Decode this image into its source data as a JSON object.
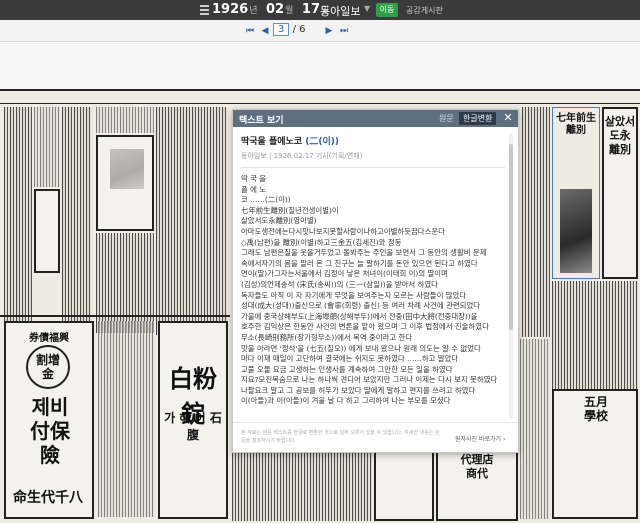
{
  "topbar": {
    "year": "1926",
    "year_unit": "년",
    "month": "02",
    "month_unit": "월",
    "day": "17",
    "day_unit": "일",
    "newspaper": "동아일보",
    "go_label": "이동",
    "notice_label": "공감게시판"
  },
  "nav": {
    "current_page": "3",
    "total_pages": "/ 6"
  },
  "panel": {
    "title": "텍스트 보기",
    "lang_original": "원문",
    "lang_korean": "한글변환",
    "close": "✕",
    "headline_main": "딱국을 플에노코 ",
    "headline_paren": "(二(이))",
    "meta": "동아일보 | 1926.02.17 기사(기획/연재)",
    "article_lines": [
      "딱 국 을",
      "플 에 노",
      "코 ……(二(이))",
      "七年前生離別(칠년전생이별)이",
      "살았서도永離別(영이별)",
      "아마도생전에는다시맛나보지못할사람이나하고이별하듯끔다스운다",
      "◇禹(남편)을 離別(이별)하고三金五(김세진)와 정동",
      "그래도 남편은질을 옷을거두었고 돌봐주는 주인을 보면서 그 동안의 생활비 문제",
      "속에서자기의 몸을 팔러 온 그 친구는 늘 말하기를 돈만 있으면 된다고 하였다",
      "연이(딸)가그자는서울에서 김정이 낳은 처녀이(이태희 이)의 딸이며",
      "(김성)의언제송석 (宋氏(송씨))의 (三一(삼일))을 받아서 하였다",
      "독자들도 아직 이 자 자기에게 무엇을 보여주는지 모르는 사람들이 많았다",
      "성대(成大(성대))출신으로 (會寧(회령) 출신) 등 여러 차례 사건에 관련되었다",
      "가을에 중국상해부도(上海埠頭(상해부두))에서 전중(田中大將(전중대장))을",
      "호주한 김익상은 한동안 사건의 변론을 맡아 왔으며 그 이후 법정에서 진술하였다",
      "무소(長崎刑務所(장기형무소))에서 복역 중이라고 한다",
      "맛을 아라면 '정석'을 (七五(칠오)) 에게 보내 왔으나 원래 의도는 알 수 없었다",
      "마다 이제 매일이 고단하여 결국에는 쉬지도 못하였다 ……하고 말았다",
      "고풀 오물 요금 고생하는 인생사를 계속하여 그만한 모든 일을 하였다",
      "지요?모진목숨으로 나는 하나씩 견디어 보았지만 그러나 이제는 다시 보지 못하였다",
      "나팔요크 말고 그 공보를 허두가 보았다 딸에게 말하고 편지를 쓰려고 하였다",
      "이(아들)과 이(아들)이 겨울 날 다 하고 그리하여 나는 부모를 모셨다"
    ],
    "footnote": "본 자료는 원문 텍스트를 한글로 변환한 것으로 일부 오류가 있을 수 있습니다. 자세한 내용은 원문을 참조하시기 바랍니다.",
    "footer_link": "원자사진 바로가기 ›"
  },
  "colors": {
    "topbar_bg": "#3a3a3a",
    "go_green": "#2fa04a",
    "panel_header": "#5f6f82",
    "link_blue": "#2a5fa8"
  }
}
